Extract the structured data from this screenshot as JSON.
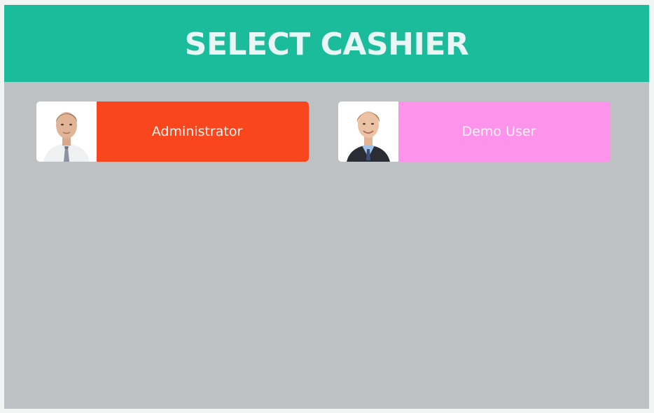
{
  "header": {
    "title": "SELECT CASHIER"
  },
  "cashiers": [
    {
      "name": "Administrator",
      "avatar_icon": "user-avatar-man-tie-icon",
      "color": "#f9461d",
      "text_color": "#f4f1ee"
    },
    {
      "name": "Demo User",
      "avatar_icon": "user-avatar-man-suit-icon",
      "color": "#fe93ec",
      "text_color": "#f7f2f7"
    }
  ],
  "colors": {
    "header_bg": "#1bbc9b",
    "body_bg": "#bdc1c4"
  }
}
